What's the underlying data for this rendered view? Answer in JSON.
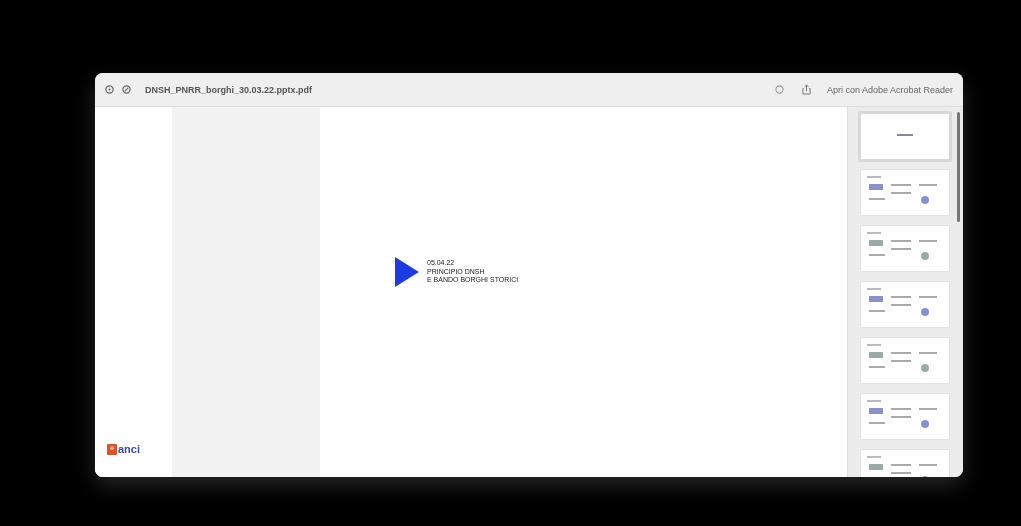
{
  "window": {
    "title": "DNSH_PNRR_borghi_30.03.22.pptx.pdf",
    "open_with": "Apri con Adobe Acrobat Reader"
  },
  "slide": {
    "date": "05.04.22",
    "lines": [
      "PRINCIPIO DNSH",
      "E BANDO BORGHI STORICI"
    ],
    "logo": "anci"
  },
  "thumbnails": [
    {
      "selected": true
    },
    {
      "selected": false
    },
    {
      "selected": false
    },
    {
      "selected": false
    },
    {
      "selected": false
    },
    {
      "selected": false
    },
    {
      "selected": false
    }
  ]
}
